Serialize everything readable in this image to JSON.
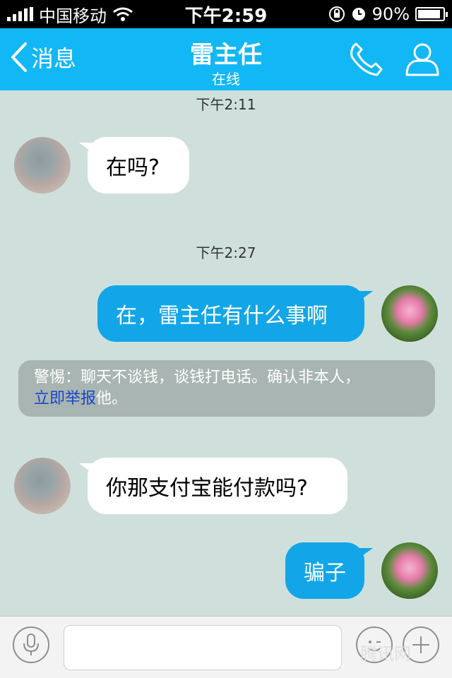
{
  "status_bar": {
    "carrier": "中国移动",
    "time": "下午2:59",
    "battery": "90%",
    "battery_level": 0.9
  },
  "header": {
    "back_label": "消息",
    "title": "雷主任",
    "subtitle": "在线"
  },
  "messages": [
    {
      "type": "timestamp",
      "text": "下午2:11"
    },
    {
      "type": "incoming",
      "text": "在吗?"
    },
    {
      "type": "timestamp",
      "text": "下午2:27"
    },
    {
      "type": "outgoing",
      "text": "在，雷主任有什么事啊"
    },
    {
      "type": "warning",
      "text": "警惕：聊天不谈钱，谈钱打电话。确认非本人，",
      "link": "立即举报",
      "suffix": "他。"
    },
    {
      "type": "incoming",
      "text": "你那支付宝能付款吗?"
    },
    {
      "type": "outgoing",
      "text": "骗子"
    }
  ],
  "input_bar": {
    "placeholder": "",
    "value": ""
  },
  "icons": {
    "voice": "microphone-icon",
    "emoji": "emoji-icon",
    "more": "plus-icon",
    "call": "phone-icon",
    "profile": "person-icon"
  },
  "colors": {
    "header": "#12b7f5",
    "outgoing_bubble": "#12a6e8",
    "incoming_bubble": "#ffffff",
    "background": "#cfe0dc",
    "warning_link": "#1846c9"
  },
  "watermark": "腾讯网"
}
